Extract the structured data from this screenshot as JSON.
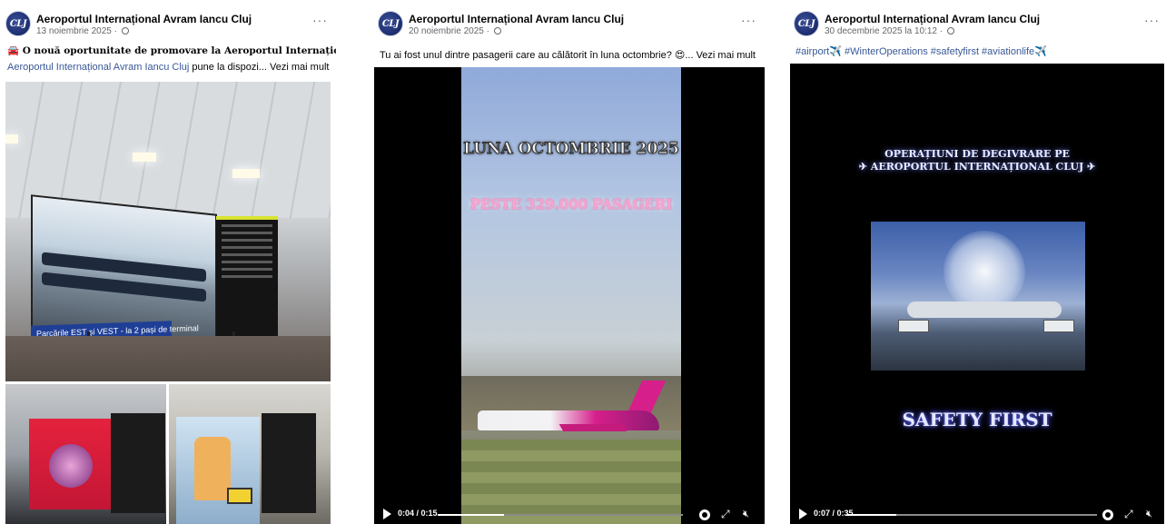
{
  "posts": [
    {
      "page_name": "Aeroportul Internațional Avram Iancu Cluj",
      "avatar_text": "CLJ",
      "date": "13 noiembrie 2025 · ",
      "line1": "🚘 O nouă oportunitate de promovare la Aeroportul Internațional Cluj!",
      "link_text": "Aeroportul Internațional Avram Iancu Cluj",
      "line2_rest": " pune la dispozi... ",
      "see_more": "Vezi mai mult",
      "photo_caption": "Parcările EST și VEST - la 2 pași de terminal"
    },
    {
      "page_name": "Aeroportul Internațional Avram Iancu Cluj",
      "avatar_text": "CLJ",
      "date": "20 noiembrie 2025 · ",
      "text": "Tu ai fost unul dintre pasagerii care au călătorit în luna octombrie? 😍... ",
      "see_more": "Vezi mai mult",
      "video_title_1": "LUNA OCTOMBRIE 2025",
      "video_title_2": "PESTE 329.000 PASAGERI",
      "time": "0:04 / 0:15",
      "progress": 0.27
    },
    {
      "page_name": "Aeroportul Internațional Avram Iancu Cluj",
      "avatar_text": "CLJ",
      "date": "30 decembrie 2025 la 10:12 · ",
      "hashtags": "#airport✈️ #WinterOperations #safetyfirst #aviationlife✈️",
      "video_title_1": "OPERAȚIUNI DE DEGIVRARE PE",
      "video_title_2": "✈ AEROPORTUL INTERNAȚIONAL CLUJ ✈",
      "video_title_3": "SAFETY FIRST",
      "time": "0:07 / 0:35",
      "progress": 0.2
    }
  ],
  "more_label": "···",
  "icons": {
    "more": "more-icon",
    "play": "play-icon",
    "settings": "gear-icon",
    "fullscreen": "expand-icon",
    "volume": "muted-speaker-icon",
    "privacy": "globe-icon"
  }
}
